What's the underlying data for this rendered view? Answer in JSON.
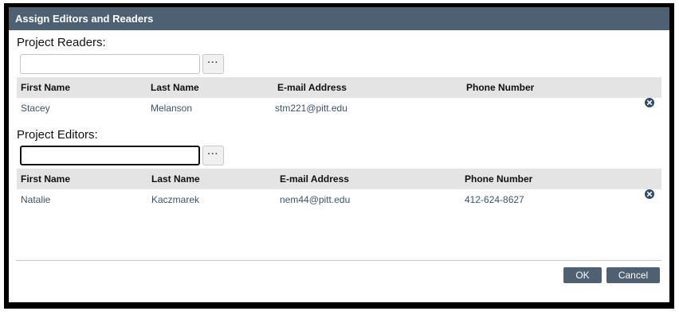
{
  "dialog": {
    "title": "Assign Editors and Readers"
  },
  "readers": {
    "label": "Project Readers:",
    "input_value": "",
    "lookup_button": "···",
    "columns": [
      "First Name",
      "Last Name",
      "E-mail Address",
      "Phone Number"
    ],
    "rows": [
      {
        "first_name": "Stacey",
        "last_name": "Melanson",
        "email": "stm221@pitt.edu",
        "phone": ""
      }
    ]
  },
  "editors": {
    "label": "Project Editors:",
    "input_value": "",
    "lookup_button": "···",
    "columns": [
      "First Name",
      "Last Name",
      "E-mail Address",
      "Phone Number"
    ],
    "rows": [
      {
        "first_name": "Natalie",
        "last_name": "Kaczmarek",
        "email": "nem44@pitt.edu",
        "phone": "412-624-8627"
      }
    ]
  },
  "footer": {
    "ok_label": "OK",
    "cancel_label": "Cancel"
  },
  "icons": {
    "remove": "close-circle-icon",
    "lookup": "ellipsis-icon"
  },
  "colors": {
    "titlebar": "#4e6172",
    "button": "#4e6172",
    "row_text": "#3d5468",
    "header_bg": "#e4e4e4"
  }
}
